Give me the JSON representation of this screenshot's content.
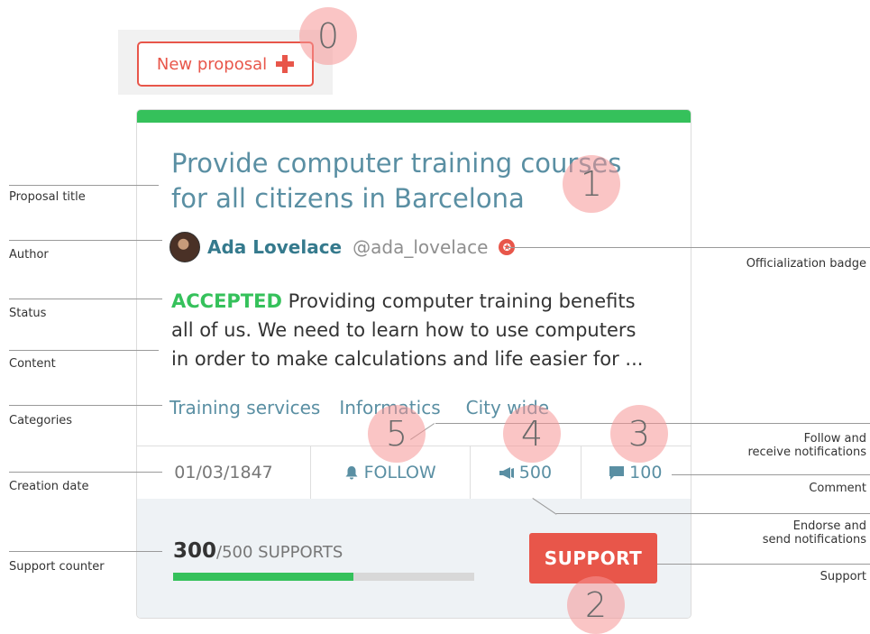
{
  "new_proposal": {
    "label": "New proposal"
  },
  "markers": [
    "0",
    "1",
    "2",
    "3",
    "4",
    "5"
  ],
  "card": {
    "title_line1": "Provide computer training courses",
    "title_line2": "for all citizens in Barcelona",
    "author_name": "Ada Lovelace",
    "author_nickname": "@ada_lovelace",
    "status": "ACCEPTED",
    "content_line1": "Providing computer training benefits",
    "content_line2": "all of us. We need to learn how to use computers",
    "content_line3": "in order to make calculations and life easier for ...",
    "categories": [
      "Training services",
      "Informatics",
      "City wide"
    ],
    "date": "01/03/1847",
    "follow_label": "FOLLOW",
    "endorsements": "500",
    "comments": "100",
    "support_count": "300",
    "support_total": "/500 SUPPORTS",
    "support_progress": 0.6,
    "support_button": "SUPPORT"
  },
  "annotations_left": [
    "Proposal title",
    "Author",
    "Status",
    "Content",
    "Categories",
    "Creation date",
    "Support counter"
  ],
  "annotations_right": {
    "officialization": "Officialization badge",
    "follow_line1": "Follow and",
    "follow_line2": "receive notifications",
    "comment": "Comment",
    "endorse_line1": "Endorse and",
    "endorse_line2": "send notifications",
    "support": "Support"
  },
  "colors": {
    "accent": "#e8564a",
    "green": "#35c15b",
    "link": "#5a8fa3"
  }
}
